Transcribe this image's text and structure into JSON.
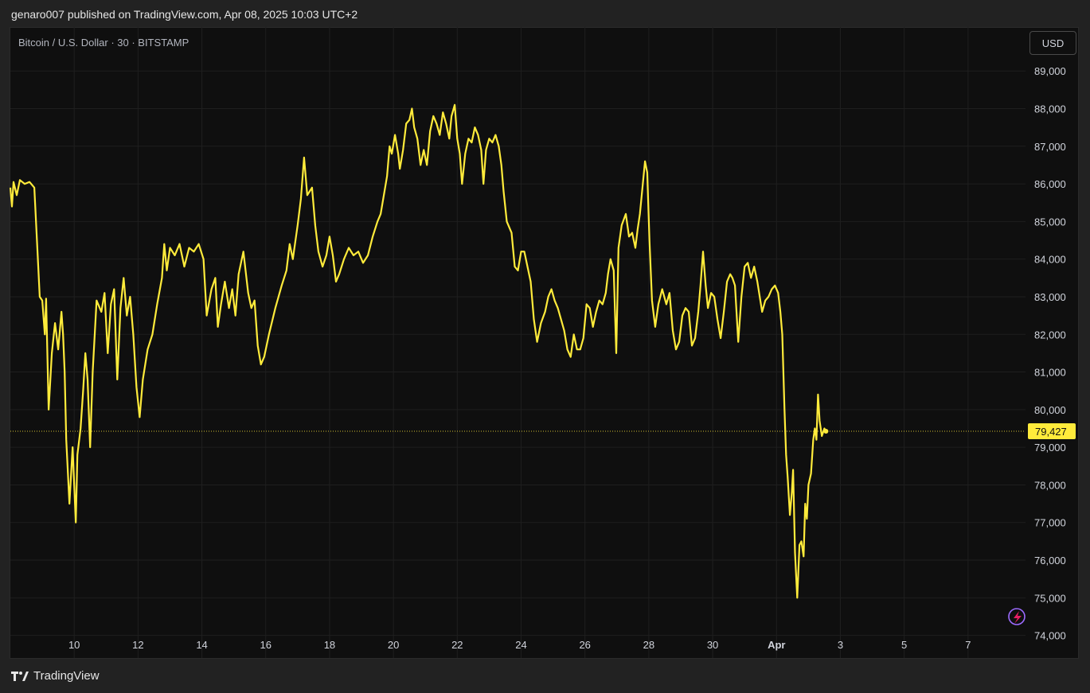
{
  "header": {
    "publish_text": "genaro007 published on TradingView.com, Apr 08, 2025 10:03 UTC+2"
  },
  "symbol": {
    "label": "Bitcoin / U.S. Dollar · 30 · BITSTAMP"
  },
  "toolbar": {
    "currency_label": "USD"
  },
  "footer": {
    "brand": "TradingView"
  },
  "colors": {
    "line": "#ffeb3b",
    "background": "#0f0f0f",
    "grid": "#1f1f1f",
    "text": "#d1d4dc",
    "badge_text": "#111111"
  },
  "chart_data": {
    "type": "line",
    "series": [
      {
        "values": [
          [
            8.0,
            85900
          ],
          [
            8.05,
            85400
          ],
          [
            8.1,
            86050
          ],
          [
            8.2,
            85700
          ],
          [
            8.3,
            86100
          ],
          [
            8.45,
            86000
          ],
          [
            8.6,
            86050
          ],
          [
            8.75,
            85900
          ],
          [
            8.85,
            84200
          ],
          [
            8.92,
            83000
          ],
          [
            9.0,
            82900
          ],
          [
            9.08,
            82000
          ],
          [
            9.12,
            82950
          ],
          [
            9.2,
            80000
          ],
          [
            9.3,
            81500
          ],
          [
            9.4,
            82300
          ],
          [
            9.5,
            81600
          ],
          [
            9.6,
            82600
          ],
          [
            9.65,
            82000
          ],
          [
            9.7,
            81000
          ],
          [
            9.75,
            79200
          ],
          [
            9.85,
            77500
          ],
          [
            9.95,
            79000
          ],
          [
            10.05,
            77000
          ],
          [
            10.1,
            78800
          ],
          [
            10.2,
            79500
          ],
          [
            10.28,
            80500
          ],
          [
            10.35,
            81500
          ],
          [
            10.42,
            80800
          ],
          [
            10.5,
            79000
          ],
          [
            10.58,
            81000
          ],
          [
            10.7,
            82900
          ],
          [
            10.85,
            82600
          ],
          [
            10.95,
            83100
          ],
          [
            11.05,
            81500
          ],
          [
            11.15,
            82800
          ],
          [
            11.25,
            83200
          ],
          [
            11.35,
            80800
          ],
          [
            11.45,
            82700
          ],
          [
            11.55,
            83500
          ],
          [
            11.65,
            82500
          ],
          [
            11.75,
            83000
          ],
          [
            11.85,
            82000
          ],
          [
            11.95,
            80600
          ],
          [
            12.05,
            79800
          ],
          [
            12.15,
            80800
          ],
          [
            12.3,
            81600
          ],
          [
            12.45,
            82000
          ],
          [
            12.6,
            82800
          ],
          [
            12.75,
            83500
          ],
          [
            12.82,
            84400
          ],
          [
            12.9,
            83700
          ],
          [
            13.0,
            84300
          ],
          [
            13.15,
            84100
          ],
          [
            13.3,
            84400
          ],
          [
            13.45,
            83800
          ],
          [
            13.6,
            84300
          ],
          [
            13.75,
            84200
          ],
          [
            13.9,
            84400
          ],
          [
            14.05,
            84000
          ],
          [
            14.15,
            82500
          ],
          [
            14.3,
            83200
          ],
          [
            14.42,
            83500
          ],
          [
            14.5,
            82200
          ],
          [
            14.6,
            82800
          ],
          [
            14.72,
            83400
          ],
          [
            14.85,
            82700
          ],
          [
            14.95,
            83200
          ],
          [
            15.05,
            82500
          ],
          [
            15.15,
            83600
          ],
          [
            15.3,
            84200
          ],
          [
            15.45,
            83100
          ],
          [
            15.55,
            82700
          ],
          [
            15.65,
            82900
          ],
          [
            15.75,
            81700
          ],
          [
            15.85,
            81200
          ],
          [
            15.95,
            81400
          ],
          [
            16.1,
            82000
          ],
          [
            16.3,
            82700
          ],
          [
            16.5,
            83300
          ],
          [
            16.65,
            83700
          ],
          [
            16.75,
            84400
          ],
          [
            16.85,
            84000
          ],
          [
            17.0,
            84900
          ],
          [
            17.1,
            85600
          ],
          [
            17.2,
            86700
          ],
          [
            17.3,
            85700
          ],
          [
            17.45,
            85900
          ],
          [
            17.55,
            84900
          ],
          [
            17.65,
            84200
          ],
          [
            17.78,
            83800
          ],
          [
            17.9,
            84100
          ],
          [
            18.0,
            84600
          ],
          [
            18.1,
            84100
          ],
          [
            18.2,
            83400
          ],
          [
            18.3,
            83600
          ],
          [
            18.45,
            84000
          ],
          [
            18.6,
            84300
          ],
          [
            18.75,
            84100
          ],
          [
            18.9,
            84200
          ],
          [
            19.05,
            83900
          ],
          [
            19.2,
            84100
          ],
          [
            19.35,
            84600
          ],
          [
            19.5,
            85000
          ],
          [
            19.6,
            85200
          ],
          [
            19.7,
            85700
          ],
          [
            19.8,
            86200
          ],
          [
            19.88,
            87000
          ],
          [
            19.95,
            86800
          ],
          [
            20.05,
            87300
          ],
          [
            20.15,
            86800
          ],
          [
            20.2,
            86400
          ],
          [
            20.3,
            86900
          ],
          [
            20.4,
            87600
          ],
          [
            20.5,
            87700
          ],
          [
            20.58,
            88000
          ],
          [
            20.65,
            87500
          ],
          [
            20.75,
            87200
          ],
          [
            20.85,
            86500
          ],
          [
            20.95,
            86900
          ],
          [
            21.05,
            86500
          ],
          [
            21.15,
            87400
          ],
          [
            21.25,
            87800
          ],
          [
            21.35,
            87600
          ],
          [
            21.45,
            87300
          ],
          [
            21.55,
            87900
          ],
          [
            21.65,
            87600
          ],
          [
            21.75,
            87200
          ],
          [
            21.82,
            87800
          ],
          [
            21.92,
            88100
          ],
          [
            22.0,
            87200
          ],
          [
            22.08,
            86800
          ],
          [
            22.15,
            86000
          ],
          [
            22.25,
            86800
          ],
          [
            22.35,
            87200
          ],
          [
            22.45,
            87100
          ],
          [
            22.55,
            87500
          ],
          [
            22.65,
            87300
          ],
          [
            22.75,
            86900
          ],
          [
            22.82,
            86000
          ],
          [
            22.9,
            86900
          ],
          [
            23.0,
            87200
          ],
          [
            23.1,
            87100
          ],
          [
            23.2,
            87300
          ],
          [
            23.3,
            87000
          ],
          [
            23.38,
            86500
          ],
          [
            23.45,
            85800
          ],
          [
            23.55,
            85000
          ],
          [
            23.7,
            84700
          ],
          [
            23.8,
            83800
          ],
          [
            23.9,
            83700
          ],
          [
            24.0,
            84200
          ],
          [
            24.1,
            84200
          ],
          [
            24.2,
            83800
          ],
          [
            24.3,
            83400
          ],
          [
            24.4,
            82400
          ],
          [
            24.5,
            81800
          ],
          [
            24.62,
            82300
          ],
          [
            24.75,
            82600
          ],
          [
            24.85,
            83000
          ],
          [
            24.95,
            83200
          ],
          [
            25.05,
            82900
          ],
          [
            25.15,
            82700
          ],
          [
            25.25,
            82400
          ],
          [
            25.35,
            82100
          ],
          [
            25.45,
            81600
          ],
          [
            25.55,
            81400
          ],
          [
            25.65,
            82000
          ],
          [
            25.75,
            81600
          ],
          [
            25.85,
            81600
          ],
          [
            25.95,
            81900
          ],
          [
            26.05,
            82800
          ],
          [
            26.15,
            82700
          ],
          [
            26.25,
            82200
          ],
          [
            26.35,
            82600
          ],
          [
            26.45,
            82900
          ],
          [
            26.55,
            82800
          ],
          [
            26.65,
            83100
          ],
          [
            26.72,
            83600
          ],
          [
            26.8,
            84000
          ],
          [
            26.9,
            83700
          ],
          [
            26.98,
            81500
          ],
          [
            27.05,
            84300
          ],
          [
            27.15,
            84900
          ],
          [
            27.28,
            85200
          ],
          [
            27.38,
            84600
          ],
          [
            27.48,
            84700
          ],
          [
            27.58,
            84300
          ],
          [
            27.65,
            84800
          ],
          [
            27.72,
            85200
          ],
          [
            27.8,
            85900
          ],
          [
            27.88,
            86600
          ],
          [
            27.95,
            86300
          ],
          [
            28.02,
            84500
          ],
          [
            28.1,
            82900
          ],
          [
            28.2,
            82200
          ],
          [
            28.3,
            82800
          ],
          [
            28.42,
            83200
          ],
          [
            28.55,
            82800
          ],
          [
            28.65,
            83100
          ],
          [
            28.75,
            82100
          ],
          [
            28.85,
            81600
          ],
          [
            28.95,
            81800
          ],
          [
            29.05,
            82500
          ],
          [
            29.15,
            82700
          ],
          [
            29.25,
            82600
          ],
          [
            29.35,
            81700
          ],
          [
            29.45,
            81900
          ],
          [
            29.55,
            82600
          ],
          [
            29.62,
            83300
          ],
          [
            29.7,
            84200
          ],
          [
            29.78,
            83300
          ],
          [
            29.85,
            82700
          ],
          [
            29.95,
            83100
          ],
          [
            30.05,
            83000
          ],
          [
            30.15,
            82400
          ],
          [
            30.25,
            81900
          ],
          [
            30.35,
            82600
          ],
          [
            30.45,
            83400
          ],
          [
            30.55,
            83600
          ],
          [
            30.62,
            83500
          ],
          [
            30.7,
            83300
          ],
          [
            30.8,
            81800
          ],
          [
            30.9,
            83000
          ],
          [
            31.0,
            83800
          ],
          [
            31.1,
            83900
          ],
          [
            31.2,
            83500
          ],
          [
            31.3,
            83800
          ],
          [
            31.4,
            83400
          ],
          [
            31.55,
            82600
          ],
          [
            31.65,
            82900
          ],
          [
            31.75,
            83000
          ],
          [
            31.85,
            83200
          ],
          [
            31.95,
            83300
          ],
          [
            32.05,
            83100
          ],
          [
            32.12,
            82600
          ],
          [
            32.18,
            82000
          ],
          [
            32.25,
            80000
          ],
          [
            32.3,
            78800
          ],
          [
            32.35,
            78200
          ],
          [
            32.42,
            77200
          ],
          [
            32.48,
            77800
          ],
          [
            32.52,
            78400
          ],
          [
            32.58,
            76200
          ],
          [
            32.65,
            75000
          ],
          [
            32.72,
            76400
          ],
          [
            32.78,
            76500
          ],
          [
            32.85,
            76100
          ],
          [
            32.9,
            77500
          ],
          [
            32.95,
            77100
          ],
          [
            33.0,
            78000
          ],
          [
            33.08,
            78300
          ],
          [
            33.15,
            79200
          ],
          [
            33.2,
            79500
          ],
          [
            33.25,
            79200
          ],
          [
            33.3,
            80400
          ],
          [
            33.35,
            79700
          ],
          [
            33.42,
            79300
          ],
          [
            33.5,
            79500
          ],
          [
            33.55,
            79427
          ]
        ]
      }
    ],
    "x_ticks": [
      {
        "x": 10,
        "label": "10"
      },
      {
        "x": 12,
        "label": "12"
      },
      {
        "x": 14,
        "label": "14"
      },
      {
        "x": 16,
        "label": "16"
      },
      {
        "x": 18,
        "label": "18"
      },
      {
        "x": 20,
        "label": "20"
      },
      {
        "x": 22,
        "label": "22"
      },
      {
        "x": 24,
        "label": "24"
      },
      {
        "x": 26,
        "label": "26"
      },
      {
        "x": 28,
        "label": "28"
      },
      {
        "x": 30,
        "label": "30"
      },
      {
        "x": 32,
        "label": "Apr",
        "bold": true
      },
      {
        "x": 34,
        "label": "3"
      },
      {
        "x": 36,
        "label": "5"
      },
      {
        "x": 38,
        "label": "7"
      }
    ],
    "y_ticks": [
      {
        "y": 74000,
        "label": "74,000"
      },
      {
        "y": 75000,
        "label": "75,000"
      },
      {
        "y": 76000,
        "label": "76,000"
      },
      {
        "y": 77000,
        "label": "77,000"
      },
      {
        "y": 78000,
        "label": "78,000"
      },
      {
        "y": 79000,
        "label": "79,000"
      },
      {
        "y": 80000,
        "label": "80,000"
      },
      {
        "y": 81000,
        "label": "81,000"
      },
      {
        "y": 82000,
        "label": "82,000"
      },
      {
        "y": 83000,
        "label": "83,000"
      },
      {
        "y": 84000,
        "label": "84,000"
      },
      {
        "y": 85000,
        "label": "85,000"
      },
      {
        "y": 86000,
        "label": "86,000"
      },
      {
        "y": 87000,
        "label": "87,000"
      },
      {
        "y": 88000,
        "label": "88,000"
      },
      {
        "y": 89000,
        "label": "89,000"
      }
    ],
    "x_range": [
      8.0,
      39.8
    ],
    "ylim": [
      73400,
      89300
    ],
    "last_price": {
      "value": 79427,
      "label": "79,427"
    },
    "grid": true
  }
}
